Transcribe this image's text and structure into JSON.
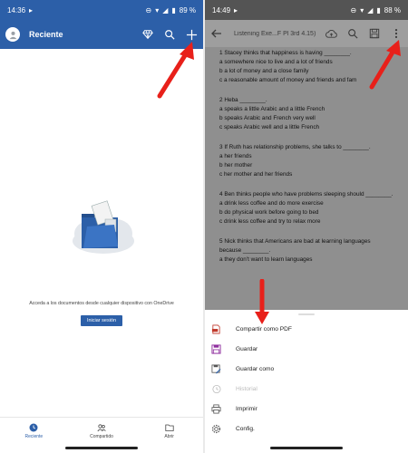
{
  "left": {
    "status": {
      "time": "14:36",
      "battery": "89 %"
    },
    "header": {
      "title": "Reciente"
    },
    "empty_message": "Acceda a los documentos desde cualquier dispositivo con OneDrive",
    "signin_label": "Iniciar sesión",
    "nav": [
      {
        "label": "Reciente",
        "icon": "clock-icon"
      },
      {
        "label": "Compartido",
        "icon": "people-icon"
      },
      {
        "label": "Abrir",
        "icon": "folder-icon"
      }
    ]
  },
  "right": {
    "status": {
      "time": "14:49",
      "battery": "88 %"
    },
    "toolbar": {
      "title": "Listening Exe...F Pl 3rd 4.15)"
    },
    "document": {
      "questions": [
        {
          "stem": "1 Stacey thinks that happiness is having ________.",
          "options": [
            "a somewhere nice to live and a lot of friends",
            "b a lot of money and a close family",
            "c a reasonable amount of money and friends and fam"
          ]
        },
        {
          "stem": "2 Heba ________.",
          "options": [
            "a speaks a little Arabic and a little French",
            "b speaks Arabic and French very well",
            "c speaks Arabic well and a little French"
          ]
        },
        {
          "stem": "3 If Ruth has relationship problems, she talks to ________.",
          "options": [
            "a her friends",
            "b her mother",
            "c her mother and her friends"
          ]
        },
        {
          "stem": "4 Ben thinks people who have problems sleeping should ________.",
          "options": [
            "a drink less coffee and do more exercise",
            "b do physical work before going to bed",
            "c drink less coffee and try to relax more"
          ]
        },
        {
          "stem": "5 Nick thinks that Americans are bad at learning languages because ________.",
          "options": [
            "a they don't want to learn languages"
          ]
        }
      ]
    },
    "menu": [
      {
        "label": "Compartir como PDF",
        "icon": "pdf-icon",
        "enabled": true
      },
      {
        "label": "Guardar",
        "icon": "save-icon",
        "enabled": true
      },
      {
        "label": "Guardar como",
        "icon": "save-as-icon",
        "enabled": true
      },
      {
        "label": "Historial",
        "icon": "history-icon",
        "enabled": false
      },
      {
        "label": "Imprimir",
        "icon": "print-icon",
        "enabled": true
      },
      {
        "label": "Config.",
        "icon": "settings-icon",
        "enabled": true
      }
    ]
  },
  "colors": {
    "brand_blue": "#2c5fa8",
    "arrow_red": "#e8201a",
    "pdf_red": "#c0392b",
    "save_purple": "#8e2d9e"
  }
}
